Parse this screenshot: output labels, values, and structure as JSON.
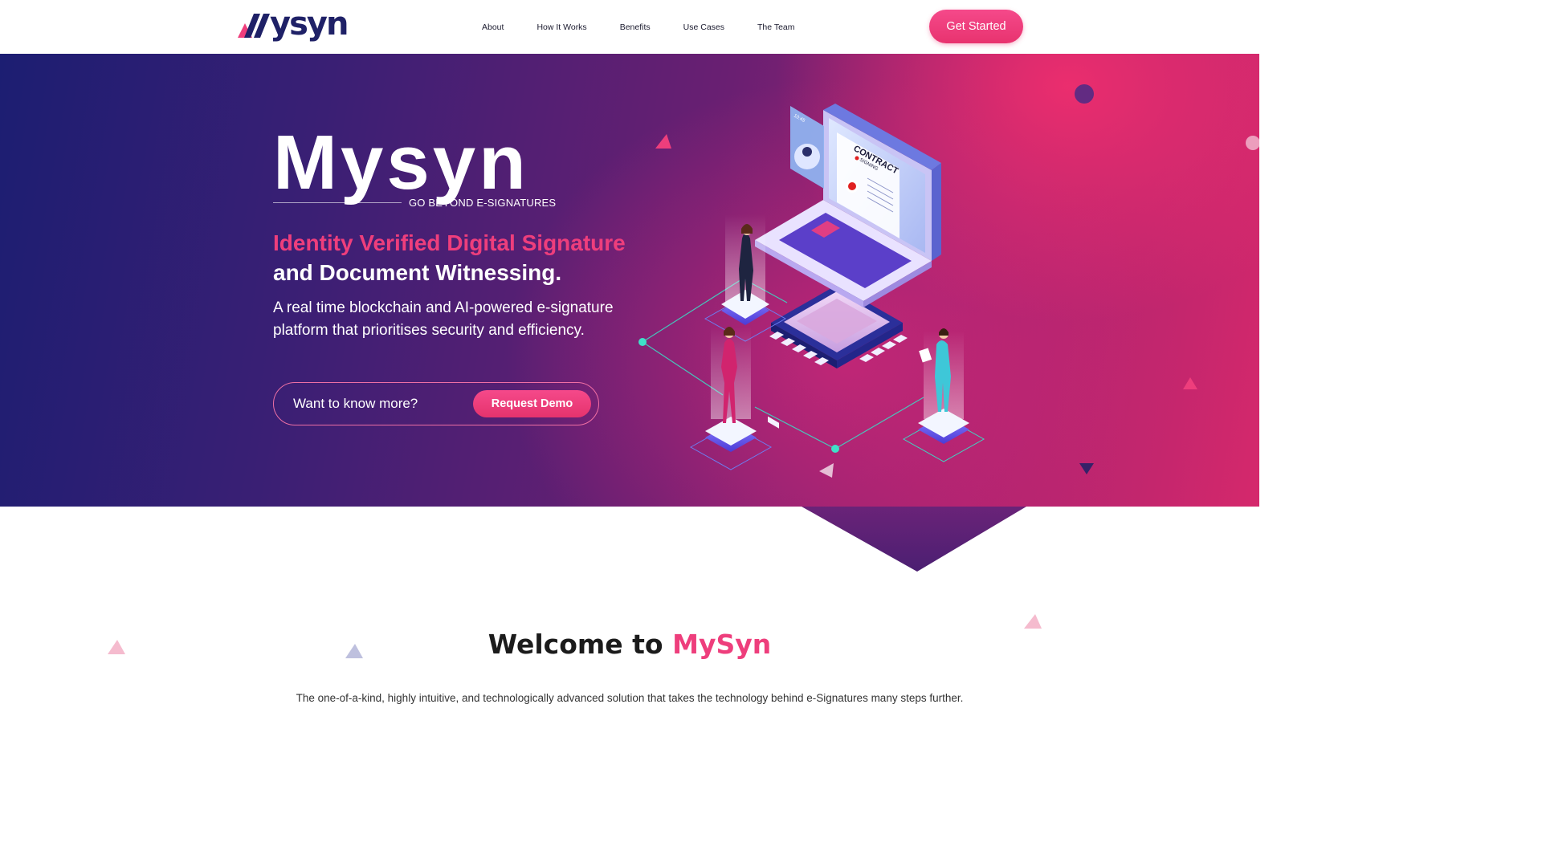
{
  "colors": {
    "brand_navy": "#1f2167",
    "brand_pink": "#ee3e7c",
    "hero_left": "#1c1e72",
    "hero_right": "#d5286c"
  },
  "nav": {
    "logo_text": "ysyn",
    "links": [
      "About",
      "How It Works",
      "Benefits",
      "Use Cases",
      "The Team"
    ],
    "cta_label": "Get Started"
  },
  "hero": {
    "brand": "Mysyn",
    "tagline": "GO BEYOND E-SIGNATURES",
    "title_line1": "Identity Verified Digital Signature",
    "title_line2": "and Document Witnessing.",
    "description": "A real time blockchain and AI-powered e-signature platform that prioritises security and efficiency.",
    "cta_prompt": "Want to know more?",
    "cta_button": "Request Demo",
    "illustration": {
      "contract_label": "CONTRACT",
      "signing_label": "SIGNING",
      "clock_label": "10:45"
    }
  },
  "welcome": {
    "title_prefix": "Welcome to",
    "title_accent": "MySyn",
    "description": "The one-of-a-kind, highly intuitive, and technologically advanced solution that takes the technology behind e-Signatures many steps further."
  }
}
